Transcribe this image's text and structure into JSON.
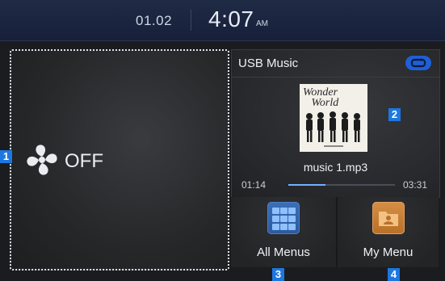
{
  "status_bar": {
    "date": "01.02",
    "time": "4:07",
    "ampm": "AM"
  },
  "climate_panel": {
    "icon": "fan-icon",
    "status": "OFF"
  },
  "music_panel": {
    "source": "USB Music",
    "repeat_icon": "repeat-icon",
    "album_art_text": "Wonder World",
    "track_name": "music 1.mp3",
    "elapsed": "01:14",
    "duration": "03:31",
    "progress_percent": 35
  },
  "menus": [
    {
      "label": "All Menus",
      "icon": "grid-icon"
    },
    {
      "label": "My Menu",
      "icon": "folder-person-icon"
    }
  ],
  "callouts": [
    "1",
    "2",
    "3",
    "4"
  ],
  "colors": {
    "accent": "#1d77e0",
    "status_bar": "#1f2a45",
    "background": "#1b1c1f"
  }
}
